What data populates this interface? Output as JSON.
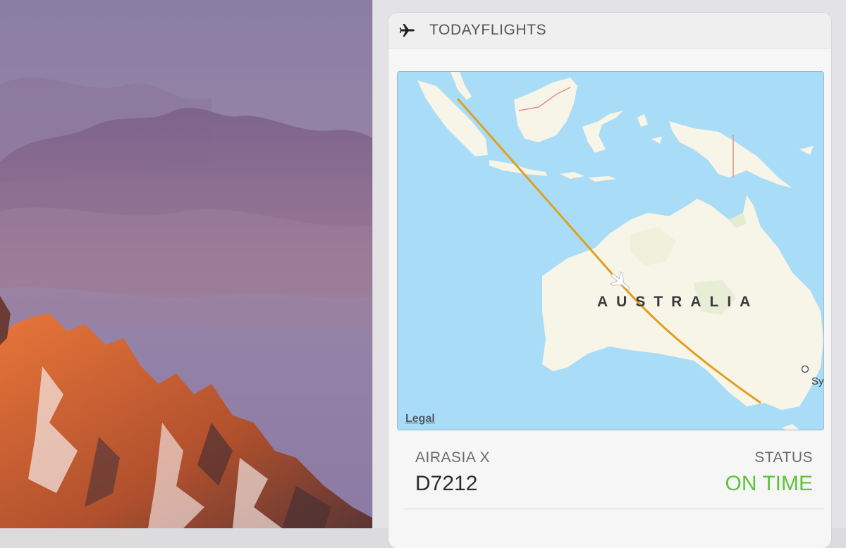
{
  "widget": {
    "title": "TODAYFLIGHTS",
    "icon": "airplane-icon"
  },
  "map": {
    "country_label": "AUSTRALIA",
    "city_label_partial": "Sy",
    "legal_label": "Legal",
    "route_color": "#e0a020",
    "ocean_color": "#a9dcf6",
    "land_color": "#f7f4e8"
  },
  "flight": {
    "airline_label": "AIRASIA X",
    "flight_number": "D7212",
    "status_label": "STATUS",
    "status_value": "ON TIME",
    "status_color": "#5ec43a"
  }
}
